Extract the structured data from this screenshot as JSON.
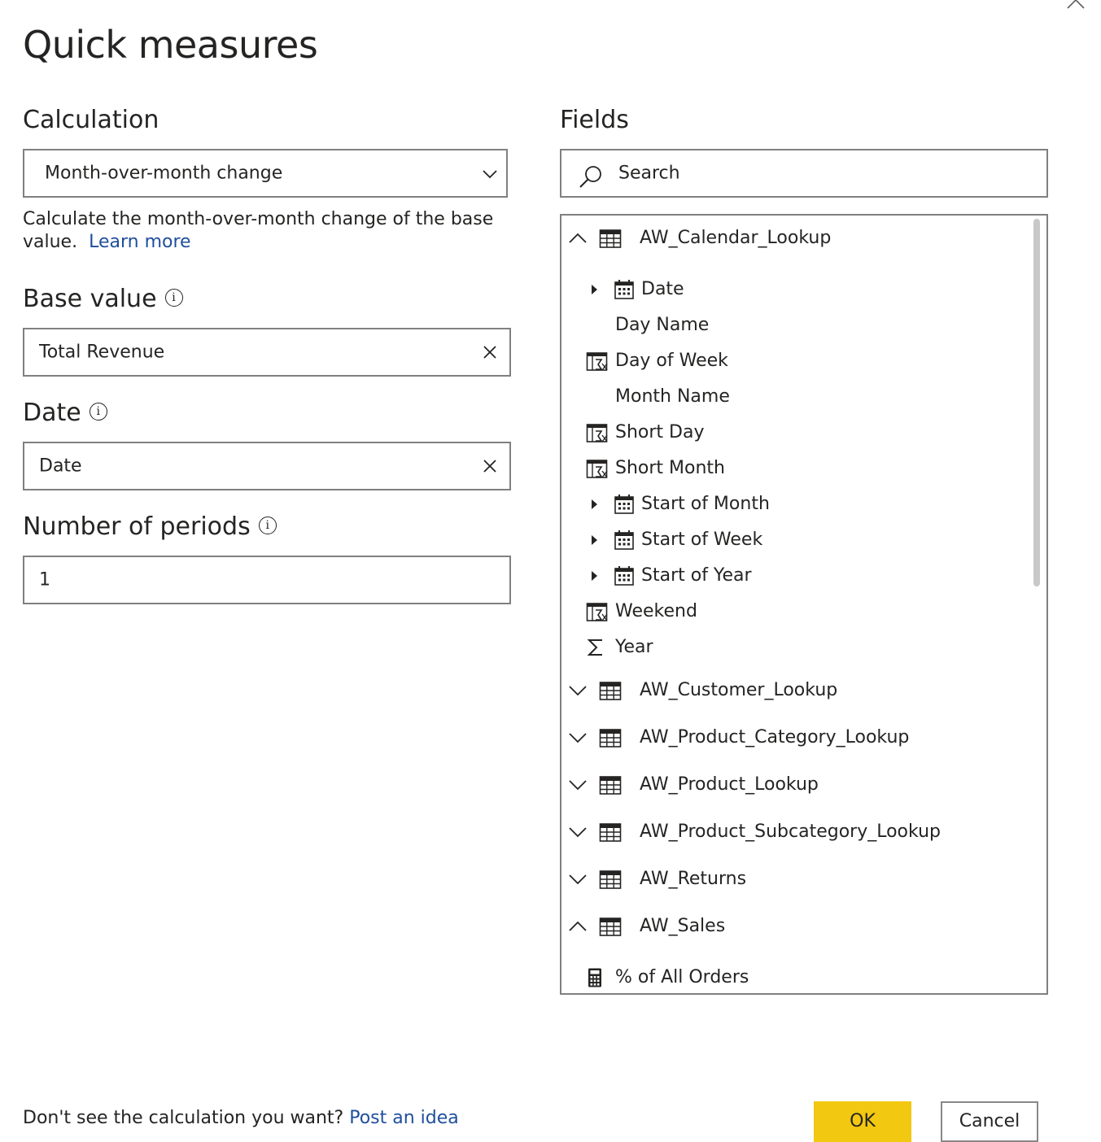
{
  "dialog": {
    "title": "Quick measures"
  },
  "calculation": {
    "label": "Calculation",
    "selected": "Month-over-month change",
    "description": "Calculate the month-over-month change of the base value.",
    "learn_more": "Learn more"
  },
  "base_value": {
    "label": "Base value",
    "value": "Total Revenue"
  },
  "date": {
    "label": "Date",
    "value": "Date"
  },
  "periods": {
    "label": "Number of periods",
    "value": "1"
  },
  "fields": {
    "label": "Fields",
    "search_placeholder": "Search",
    "tables": [
      {
        "name": "AW_Calendar_Lookup",
        "expanded": true
      },
      {
        "name": "AW_Customer_Lookup",
        "expanded": false
      },
      {
        "name": "AW_Product_Category_Lookup",
        "expanded": false
      },
      {
        "name": "AW_Product_Lookup",
        "expanded": false
      },
      {
        "name": "AW_Product_Subcategory_Lookup",
        "expanded": false
      },
      {
        "name": "AW_Returns",
        "expanded": false
      },
      {
        "name": "AW_Sales",
        "expanded": true
      }
    ],
    "calendar_fields": [
      {
        "name": "Date",
        "icon": "calendar-icon",
        "expandable": true
      },
      {
        "name": "Day Name",
        "icon": "none",
        "expandable": false
      },
      {
        "name": "Day of Week",
        "icon": "calculated-column-icon",
        "expandable": false
      },
      {
        "name": "Month Name",
        "icon": "none",
        "expandable": false
      },
      {
        "name": "Short Day",
        "icon": "calculated-column-icon",
        "expandable": false
      },
      {
        "name": "Short Month",
        "icon": "calculated-column-icon",
        "expandable": false
      },
      {
        "name": "Start of Month",
        "icon": "calendar-icon",
        "expandable": true
      },
      {
        "name": "Start of Week",
        "icon": "calendar-icon",
        "expandable": true
      },
      {
        "name": "Start of Year",
        "icon": "calendar-icon",
        "expandable": true
      },
      {
        "name": "Weekend",
        "icon": "calculated-column-icon",
        "expandable": false
      },
      {
        "name": "Year",
        "icon": "sigma-icon",
        "expandable": false
      }
    ],
    "sales_fields": [
      {
        "name": "% of All Orders",
        "icon": "calculator-icon"
      }
    ]
  },
  "footer": {
    "prompt": "Don't see the calculation you want?",
    "link": "Post an idea",
    "ok": "OK",
    "cancel": "Cancel"
  }
}
